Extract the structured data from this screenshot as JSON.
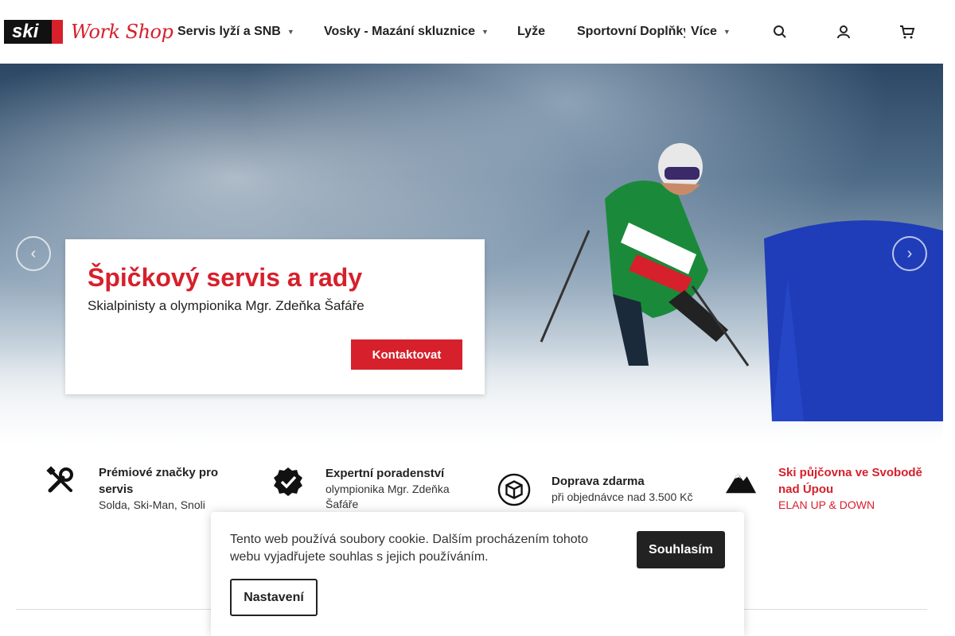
{
  "header": {
    "logo_ski": "ski",
    "logo_work": "Work Shop",
    "nav": [
      {
        "label": "Servis lyží a SNB"
      },
      {
        "label": "Vosky - Mazání skluznice"
      },
      {
        "label": "Lyže"
      },
      {
        "label": "Sportovní Doplňky"
      },
      {
        "label": "Více"
      }
    ],
    "icons": [
      "search-icon",
      "user-icon",
      "cart-icon"
    ]
  },
  "hero": {
    "title": "Špičkový servis a rady",
    "subtitle": "Skialpinisty a olympionika Mgr. Zdeňka Šafáře",
    "button": "Kontaktovat"
  },
  "features": [
    {
      "title": "Prémiové značky pro servis",
      "sub": "Solda, Ski-Man, Snoli",
      "icon": "tools-icon"
    },
    {
      "title": "Expertní poradenství",
      "sub": "olympionika Mgr. Zdeňka Šafáře",
      "icon": "verified-badge-icon"
    },
    {
      "title": "Doprava zdarma",
      "sub": "při objednávce nad 3.500 Kč",
      "icon": "package-icon"
    },
    {
      "title": "Ski půjčovna ve Svobodě nad Úpou",
      "sub": "ELAN UP & DOWN",
      "icon": "mountain-icon"
    }
  ],
  "cookie": {
    "text": "Tento web používá soubory cookie. Dalším procházením tohoto webu vyjadřujete souhlas s jejich používáním.",
    "accept": "Souhlasím",
    "settings": "Nastavení"
  },
  "colors": {
    "accent": "#d6202c",
    "dark": "#222222"
  }
}
